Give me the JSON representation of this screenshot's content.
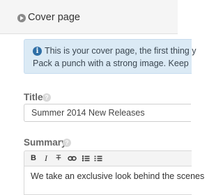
{
  "header": {
    "title": "Cover page"
  },
  "info": {
    "line1": "This is your cover page, the first thing y",
    "line2": "Pack a punch with a strong image. Keep"
  },
  "title_field": {
    "label": "Title",
    "value": "Summer 2014 New Releases"
  },
  "summary_field": {
    "label": "Summary",
    "toolbar": {
      "bold": "B",
      "italic": "I",
      "strike": "T"
    },
    "text": "We take an exclusive look behind the scenes"
  }
}
